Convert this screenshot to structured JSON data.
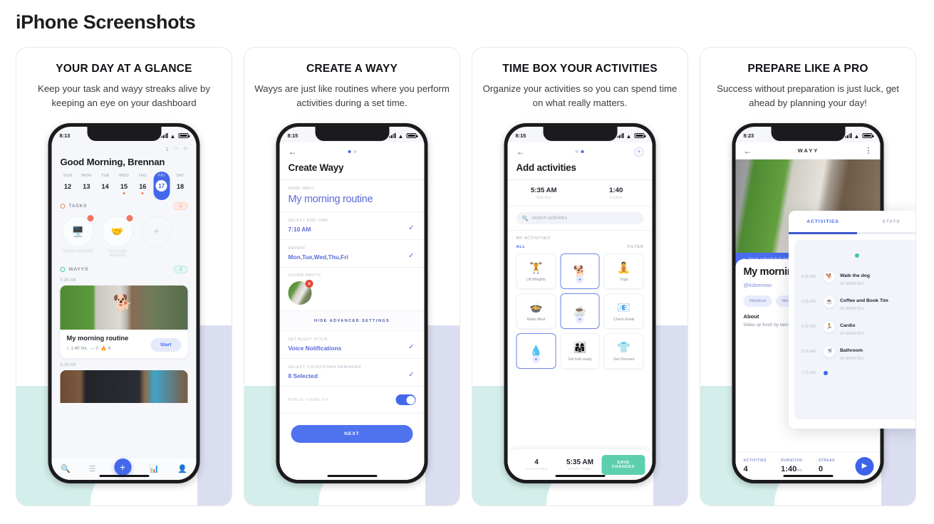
{
  "page": {
    "title": "iPhone Screenshots"
  },
  "cards": [
    {
      "title": "YOUR DAY AT A GLANCE",
      "subtitle": "Keep your task and wayy streaks alive by keeping an eye on your dashboard",
      "status_time": "8:13",
      "screen": {
        "streak_count": "1",
        "greeting": "Good Morning, Brennan",
        "week": [
          {
            "name": "SUN",
            "num": "12",
            "dot": false,
            "selected": false
          },
          {
            "name": "MON",
            "num": "13",
            "dot": false,
            "selected": false
          },
          {
            "name": "TUE",
            "num": "14",
            "dot": false,
            "selected": false
          },
          {
            "name": "WED",
            "num": "15",
            "dot": true,
            "selected": false
          },
          {
            "name": "THU",
            "num": "16",
            "dot": true,
            "selected": false
          },
          {
            "name": "FRI",
            "num": "17",
            "dot": false,
            "selected": true
          },
          {
            "name": "SAT",
            "num": "18",
            "dot": false,
            "selected": false
          }
        ],
        "tasks_label": "TASKS",
        "tasks_count": "2",
        "tasks": [
          {
            "icon": "🖥️",
            "label": "Practice JavaScript",
            "badge": true
          },
          {
            "icon": "🤝",
            "label": "Tap & Code Interviews",
            "badge": true
          }
        ],
        "add_task_icon": "+",
        "wayys_label": "WAYYS",
        "wayys_count": "2",
        "wayy_time_1": "5:35 AM",
        "wayy": {
          "title": "My morning routine",
          "duration": "1:40 hrs",
          "streak": "0",
          "fire": "4",
          "start_label": "Start",
          "photo_icon": "🐕"
        },
        "wayy_time_2": "6:28 AM",
        "tabs": [
          "search-icon",
          "list-icon",
          "add-icon",
          "stats-icon",
          "profile-icon"
        ]
      }
    },
    {
      "title": "CREATE A WAYY",
      "subtitle": "Wayys are just like routines where you perform activities during a set time.",
      "status_time": "8:15",
      "screen": {
        "header": "Create Wayy",
        "fields": [
          {
            "label": "NAME WAYY",
            "value": "My morning routine",
            "check": false,
            "big": true
          },
          {
            "label": "SELECT END TIME",
            "value": "7:10 AM",
            "check": true,
            "big": false
          },
          {
            "label": "REPEAT",
            "value": "Mon,Tue,Wed,Thu,Fri",
            "check": true,
            "big": false
          }
        ],
        "cover_label": "COVER PHOTO",
        "advanced_label": "HIDE ADVANCED SETTINGS",
        "adv_fields": [
          {
            "label": "SET ALERT STYLE",
            "value": "Voice Notifications",
            "check": true
          },
          {
            "label": "SELECT COUNTDOWN REMINDER",
            "value": "8 Selected",
            "check": true
          }
        ],
        "toggle_label": "PUBLIC VISIBILITY",
        "toggle_on": true,
        "next_label": "NEXT"
      }
    },
    {
      "title": "TIME BOX YOUR ACTIVITIES",
      "subtitle": "Organize your activities so you can spend time on what really matters.",
      "status_time": "8:15",
      "screen": {
        "header": "Add activities",
        "start_time_value": "5:35 AM",
        "start_time_label": "Start time",
        "duration_value": "1:40",
        "duration_label": "Duration",
        "search_placeholder": "search activities",
        "section_label": "MY ACTIVITIES",
        "filter_all": "ALL",
        "filter_label": "FILTER",
        "activities": [
          {
            "icon": "🏋️",
            "name": "Lift Weights",
            "selected": false
          },
          {
            "icon": "🐕",
            "name": "",
            "selected": true
          },
          {
            "icon": "🧘",
            "name": "Yoga",
            "selected": false
          },
          {
            "icon": "🍲",
            "name": "Make Meal",
            "selected": false
          },
          {
            "icon": "☕",
            "name": "",
            "selected": true
          },
          {
            "icon": "📧",
            "name": "Check Email",
            "selected": false
          },
          {
            "icon": "💧",
            "name": "",
            "selected": true
          },
          {
            "icon": "👨‍👩‍👧",
            "name": "Get kids ready",
            "selected": false
          },
          {
            "icon": "👕",
            "name": "Get Dressed",
            "selected": false
          }
        ],
        "footer_count_value": "4",
        "footer_count_label": "ACTIVITIES",
        "footer_time_value": "5:35 AM",
        "footer_time_label": "START TIME",
        "save_label": "SAVE CHANGES"
      }
    },
    {
      "title": "PREPARE LIKE A PRO",
      "subtitle": "Success without preparation is just luck, get ahead by planning your day!",
      "status_time": "8:23",
      "screen": {
        "header": "WAYY",
        "banner": "Next scheduled date is",
        "detail_title": "My morning routine",
        "handle": "@itsbrennan",
        "tags": [
          "#Workout",
          "#Everyday"
        ],
        "about_label": "About",
        "about_text": "Wake up fresh by taking care of your mind!",
        "stats": [
          {
            "label": "ACTIVITIES",
            "value": "4",
            "unit": ""
          },
          {
            "label": "DURATION",
            "value": "1:40",
            "unit": "hrs"
          },
          {
            "label": "STREAK",
            "value": "0",
            "unit": ""
          }
        ]
      }
    }
  ],
  "float_panel": {
    "tabs": [
      {
        "label": "ACTIVITIES",
        "active": true
      },
      {
        "label": "STATS",
        "active": false
      }
    ],
    "items": [
      {
        "time": "5:35 AM",
        "icon": "🐕",
        "name": "Walk the dog",
        "duration": "30 MINUTES"
      },
      {
        "time": "6:05 AM",
        "icon": "☕",
        "name": "Coffee and Book Tim",
        "duration": "30 MINUTES"
      },
      {
        "time": "6:35 AM",
        "icon": "🏃",
        "name": "Cardio",
        "duration": "20 MINUTES"
      },
      {
        "time": "6:55 AM",
        "icon": "🚿",
        "name": "Bathroom",
        "duration": "20 MINUTES"
      }
    ],
    "end_time": "7:15 AM"
  },
  "colors": {
    "brand_blue": "#4368ec",
    "teal": "#d4efeb",
    "lavender": "#dbdef0",
    "orange": "#f08a6d",
    "green": "#3fc9a5"
  }
}
